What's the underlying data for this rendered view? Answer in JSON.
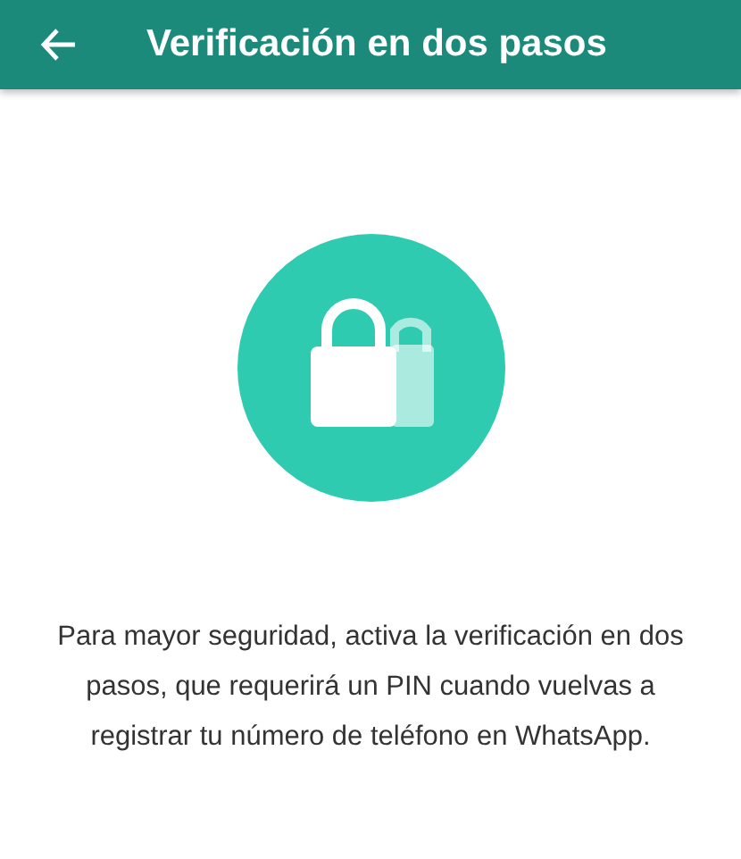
{
  "app_bar": {
    "title": "Verificación en dos pasos"
  },
  "description": "Para mayor seguridad, activa la verificación en dos pasos, que requerirá un PIN cuando vuelvas a registrar tu número de teléfono en WhatsApp."
}
